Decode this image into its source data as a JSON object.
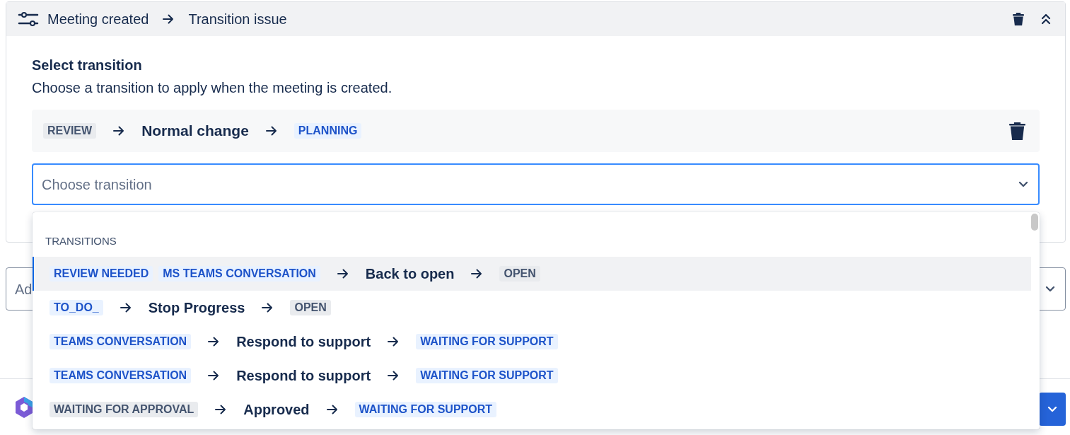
{
  "header": {
    "trigger": "Meeting created",
    "action": "Transition issue"
  },
  "section": {
    "title": "Select transition",
    "description": "Choose a transition to apply when the meeting is created."
  },
  "selected_transition": {
    "from": [
      {
        "label": "REVIEW",
        "kind": "neutral"
      }
    ],
    "name": "Normal change",
    "to": {
      "label": "PLANNING",
      "kind": "blue"
    }
  },
  "transition_select": {
    "placeholder": "Choose transition",
    "expanded": true
  },
  "dropdown": {
    "group": "TRANSITIONS",
    "options": [
      {
        "from": [
          {
            "label": "REVIEW NEEDED",
            "kind": "blue"
          },
          {
            "label": "MS TEAMS CONVERSATION",
            "kind": "blue"
          }
        ],
        "name": "Back to open",
        "to": {
          "label": "OPEN",
          "kind": "neutral"
        },
        "selected": true
      },
      {
        "from": [
          {
            "label": "TO_DO_",
            "kind": "blue"
          }
        ],
        "name": "Stop Progress",
        "to": {
          "label": "OPEN",
          "kind": "neutral"
        },
        "selected": false
      },
      {
        "from": [
          {
            "label": "TEAMS CONVERSATION",
            "kind": "blue"
          }
        ],
        "name": "Respond to support",
        "to": {
          "label": "WAITING FOR SUPPORT",
          "kind": "blue"
        },
        "selected": false
      },
      {
        "from": [
          {
            "label": "TEAMS CONVERSATION",
            "kind": "blue"
          }
        ],
        "name": "Respond to support",
        "to": {
          "label": "WAITING FOR SUPPORT",
          "kind": "blue"
        },
        "selected": false
      },
      {
        "from": [
          {
            "label": "WAITING FOR APPROVAL",
            "kind": "neutral"
          }
        ],
        "name": "Approved",
        "to": {
          "label": "WAITING FOR SUPPORT",
          "kind": "blue"
        },
        "selected": false
      }
    ]
  },
  "action_select": {
    "placeholder": "Ad"
  }
}
